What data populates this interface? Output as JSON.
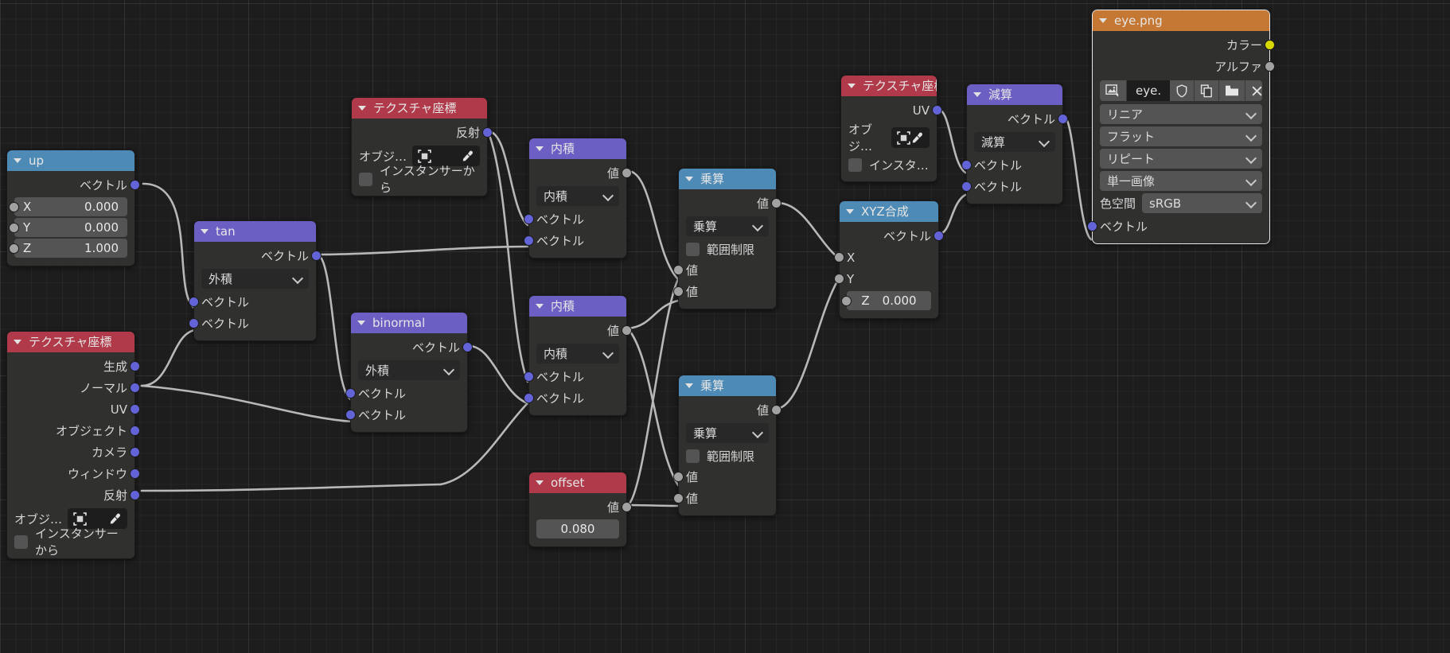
{
  "editor": {
    "name": "blender-shader-node-editor"
  },
  "socket_colors": {
    "vector": "#6363d8",
    "value": "#a1a1a1",
    "color": "#d8d800"
  },
  "nodes": {
    "up": {
      "title": "up",
      "outputs": [
        {
          "label": "ベクトル",
          "type": "vector"
        }
      ],
      "fields": [
        {
          "label": "X",
          "value": "0.000"
        },
        {
          "label": "Y",
          "value": "0.000"
        },
        {
          "label": "Z",
          "value": "1.000"
        }
      ]
    },
    "texcoord_left": {
      "title": "テクスチャ座標",
      "outputs": [
        {
          "label": "生成",
          "type": "vector"
        },
        {
          "label": "ノーマル",
          "type": "vector"
        },
        {
          "label": "UV",
          "type": "vector"
        },
        {
          "label": "オブジェクト",
          "type": "vector"
        },
        {
          "label": "カメラ",
          "type": "vector"
        },
        {
          "label": "ウィンドウ",
          "type": "vector"
        },
        {
          "label": "反射",
          "type": "vector"
        }
      ],
      "object_label": "オブジ…",
      "instancer_label": "インスタンサーから"
    },
    "tan": {
      "title": "tan",
      "outputs": [
        {
          "label": "ベクトル",
          "type": "vector"
        }
      ],
      "operation": "外積",
      "inputs": [
        {
          "label": "ベクトル",
          "type": "vector"
        },
        {
          "label": "ベクトル",
          "type": "vector"
        }
      ]
    },
    "binormal": {
      "title": "binormal",
      "outputs": [
        {
          "label": "ベクトル",
          "type": "vector"
        }
      ],
      "operation": "外積",
      "inputs": [
        {
          "label": "ベクトル",
          "type": "vector"
        },
        {
          "label": "ベクトル",
          "type": "vector"
        }
      ]
    },
    "texcoord_mid": {
      "title": "テクスチャ座標",
      "outputs": [
        {
          "label": "反射",
          "type": "vector"
        }
      ],
      "object_label": "オブジ…",
      "instancer_label": "インスタンサーから"
    },
    "dot1": {
      "title": "内積",
      "outputs": [
        {
          "label": "値",
          "type": "value"
        }
      ],
      "operation": "内積",
      "inputs": [
        {
          "label": "ベクトル",
          "type": "vector"
        },
        {
          "label": "ベクトル",
          "type": "vector"
        }
      ]
    },
    "dot2": {
      "title": "内積",
      "outputs": [
        {
          "label": "値",
          "type": "value"
        }
      ],
      "operation": "内積",
      "inputs": [
        {
          "label": "ベクトル",
          "type": "vector"
        },
        {
          "label": "ベクトル",
          "type": "vector"
        }
      ]
    },
    "offset": {
      "title": "offset",
      "outputs": [
        {
          "label": "値",
          "type": "value"
        }
      ],
      "value": "0.080"
    },
    "mul1": {
      "title": "乗算",
      "outputs": [
        {
          "label": "値",
          "type": "value"
        }
      ],
      "operation": "乗算",
      "clamp_label": "範囲制限",
      "inputs": [
        {
          "label": "値",
          "type": "value"
        },
        {
          "label": "値",
          "type": "value"
        }
      ]
    },
    "mul2": {
      "title": "乗算",
      "outputs": [
        {
          "label": "値",
          "type": "value"
        }
      ],
      "operation": "乗算",
      "clamp_label": "範囲制限",
      "inputs": [
        {
          "label": "値",
          "type": "value"
        },
        {
          "label": "値",
          "type": "value"
        }
      ]
    },
    "combine_xyz": {
      "title": "XYZ合成",
      "outputs": [
        {
          "label": "ベクトル",
          "type": "vector"
        }
      ],
      "inputs": [
        {
          "label": "X",
          "type": "value"
        },
        {
          "label": "Y",
          "type": "value"
        }
      ],
      "z_label": "Z",
      "z_value": "0.000"
    },
    "texcoord_right": {
      "title": "テクスチャ座標",
      "outputs": [
        {
          "label": "UV",
          "type": "vector"
        }
      ],
      "object_label": "オブジ…",
      "instancer_label": "インスタ…"
    },
    "subtract": {
      "title": "減算",
      "outputs": [
        {
          "label": "ベクトル",
          "type": "vector"
        }
      ],
      "operation": "減算",
      "inputs": [
        {
          "label": "ベクトル",
          "type": "vector"
        },
        {
          "label": "ベクトル",
          "type": "vector"
        }
      ]
    },
    "image_texture": {
      "title": "eye.png",
      "outputs": [
        {
          "label": "カラー",
          "type": "color"
        },
        {
          "label": "アルファ",
          "type": "value"
        }
      ],
      "image_name": "eye.",
      "interpolation": "リニア",
      "projection": "フラット",
      "extension": "リピート",
      "source": "単一画像",
      "colorspace_label": "色空間",
      "colorspace": "sRGB",
      "inputs": [
        {
          "label": "ベクトル",
          "type": "vector"
        }
      ]
    }
  }
}
